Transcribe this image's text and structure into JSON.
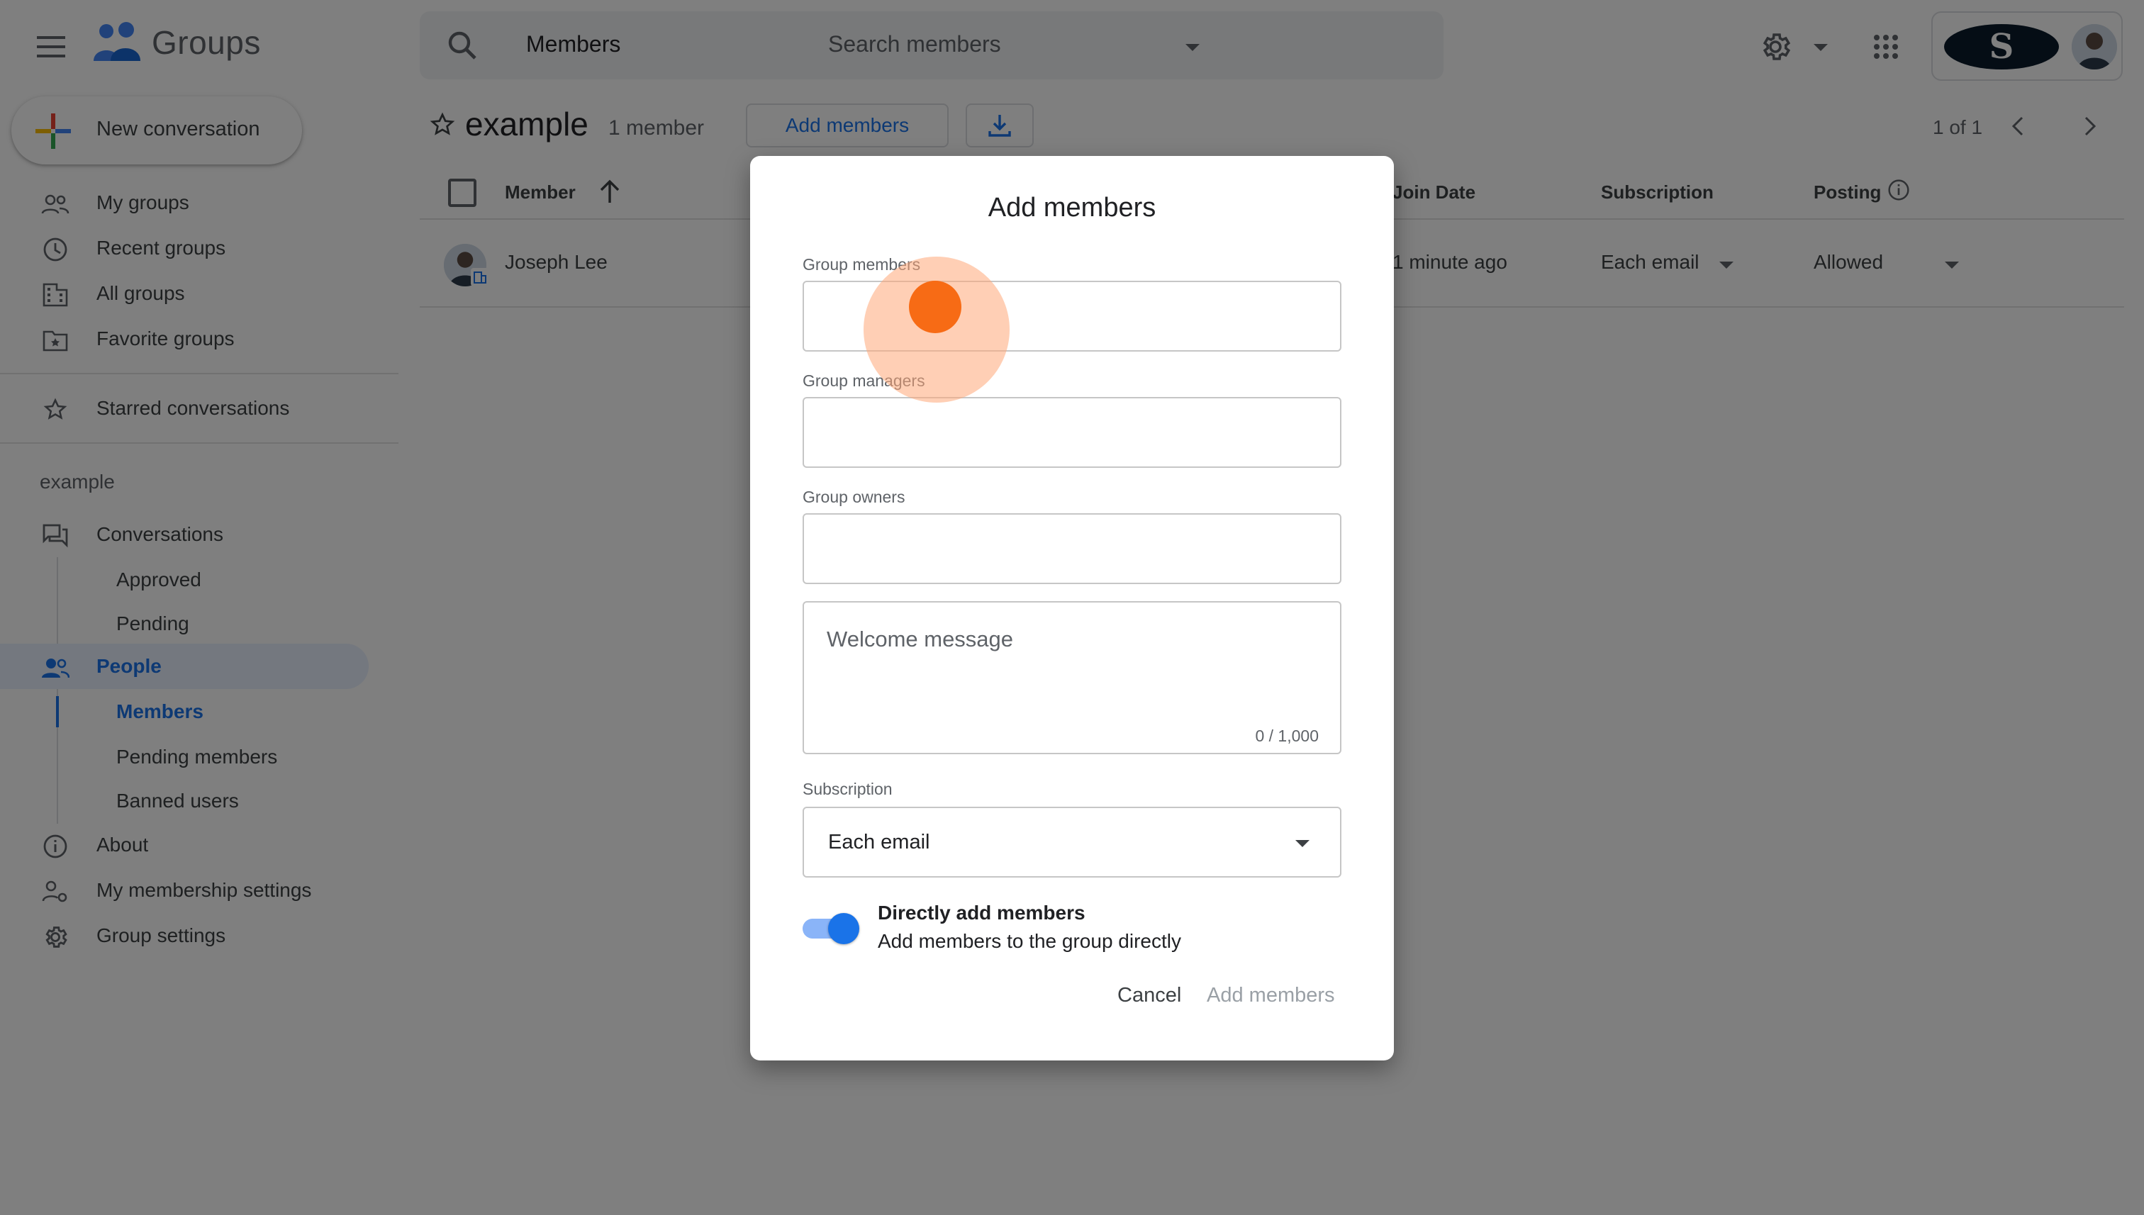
{
  "app": {
    "name": "Groups"
  },
  "search": {
    "scope": "Members",
    "placeholder": "Search members"
  },
  "account": {
    "org_initial": "S"
  },
  "sidebar": {
    "new_conversation": "New conversation",
    "items": [
      {
        "label": "My groups"
      },
      {
        "label": "Recent groups"
      },
      {
        "label": "All groups"
      },
      {
        "label": "Favorite groups"
      },
      {
        "label": "Starred conversations"
      }
    ],
    "section": "example",
    "group_nav": {
      "conversations": "Conversations",
      "approved": "Approved",
      "pending": "Pending",
      "people": "People",
      "members": "Members",
      "pending_members": "Pending members",
      "banned_users": "Banned users",
      "about": "About",
      "my_membership": "My membership settings",
      "group_settings": "Group settings"
    }
  },
  "main": {
    "group_name": "example",
    "member_count": "1 member",
    "add_members": "Add members",
    "pager": "1 of 1",
    "columns": {
      "member": "Member",
      "join_date": "Join Date",
      "subscription": "Subscription",
      "posting": "Posting"
    },
    "rows": [
      {
        "name": "Joseph Lee",
        "join_date": "1 minute ago",
        "subscription": "Each email",
        "posting": "Allowed"
      }
    ]
  },
  "dialog": {
    "title": "Add members",
    "group_members_label": "Group members",
    "group_managers_label": "Group managers",
    "group_owners_label": "Group owners",
    "welcome_placeholder": "Welcome message",
    "welcome_counter": "0 / 1,000",
    "subscription_label": "Subscription",
    "subscription_value": "Each email",
    "toggle_title": "Directly add members",
    "toggle_subtitle": "Add members to the group directly",
    "toggle_on": true,
    "cancel": "Cancel",
    "submit": "Add members"
  },
  "colors": {
    "accent": "#1a73e8",
    "click_marker": "#f76b15"
  }
}
